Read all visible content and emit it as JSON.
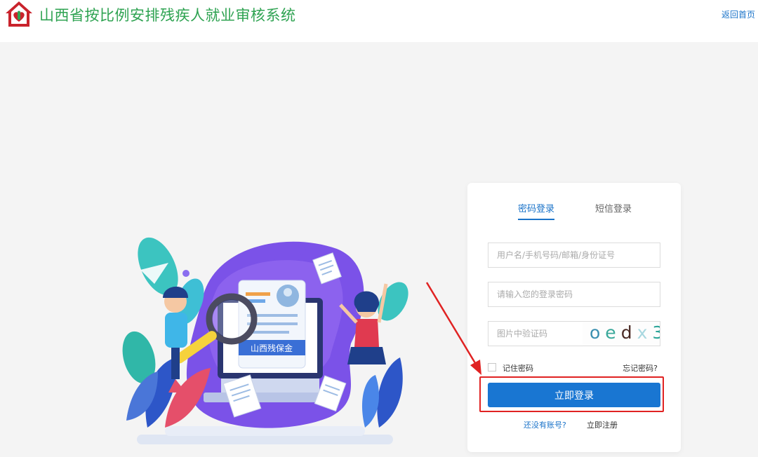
{
  "header": {
    "title": "山西省按比例安排残疾人就业审核系统",
    "home_link": "返回首页",
    "brand_color": "#2fa352",
    "logo_icon": "house-heart-logo"
  },
  "illustration": {
    "banner_text": "山西残保金"
  },
  "login": {
    "tabs": [
      {
        "label": "密码登录",
        "active": true
      },
      {
        "label": "短信登录",
        "active": false
      }
    ],
    "username_placeholder": "用户名/手机号码/邮箱/身份证号",
    "password_placeholder": "请输入您的登录密码",
    "captcha_placeholder": "图片中验证码",
    "captcha_chars": [
      "o",
      "e",
      "d",
      "x",
      "3"
    ],
    "remember_label": "记住密码",
    "remember_checked": false,
    "forgot_label": "忘记密码?",
    "submit_label": "立即登录",
    "no_account_label": "还没有账号?",
    "register_label": "立即注册",
    "accent_color": "#1976d2"
  },
  "annotation": {
    "highlight_color": "#e02222"
  }
}
